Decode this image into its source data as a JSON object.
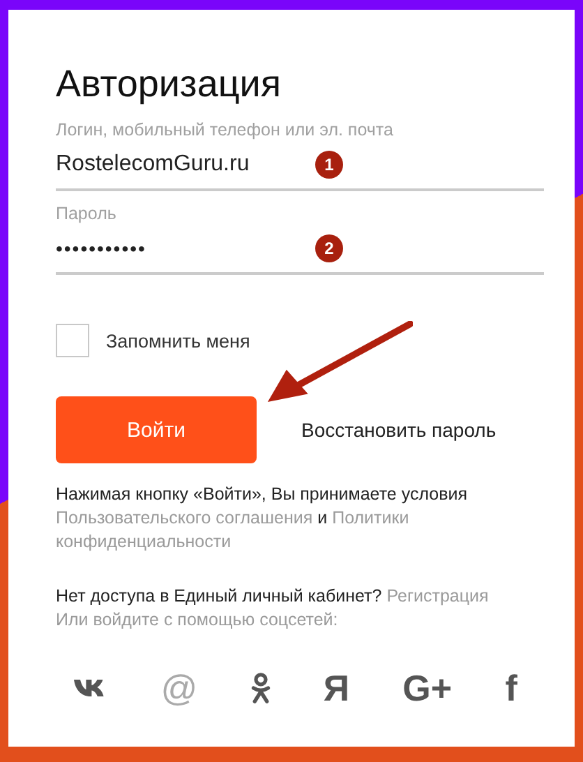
{
  "title": "Авторизация",
  "login": {
    "label": "Логин, мобильный телефон или эл. почта",
    "value": "RostelecomGuru.ru",
    "marker": "1"
  },
  "password": {
    "label": "Пароль",
    "value": "•••••••••••",
    "marker": "2"
  },
  "remember": {
    "label": "Запомнить меня",
    "checked": false
  },
  "submit": "Войти",
  "restore": "Восстановить пароль",
  "terms": {
    "text": "Нажимая кнопку «Войти», Вы принимаете условия",
    "link1": "Пользовательского соглашения",
    "joiner": "и",
    "link2": [
      "Политики",
      "конфиденциальности"
    ]
  },
  "no_access": {
    "text": "Нет доступа в Единый личный кабинет?",
    "link": "Регистрация"
  },
  "social_hint": "Или войдите с помощью соцсетей:",
  "socials": [
    {
      "kind": "vk"
    },
    {
      "kind": "glyph",
      "label": "@",
      "light": true
    },
    {
      "kind": "ok"
    },
    {
      "kind": "glyph",
      "label": "Я",
      "light": false
    },
    {
      "kind": "glyph",
      "label": "G+",
      "light": false
    },
    {
      "kind": "glyph",
      "label": "f",
      "light": false
    }
  ]
}
